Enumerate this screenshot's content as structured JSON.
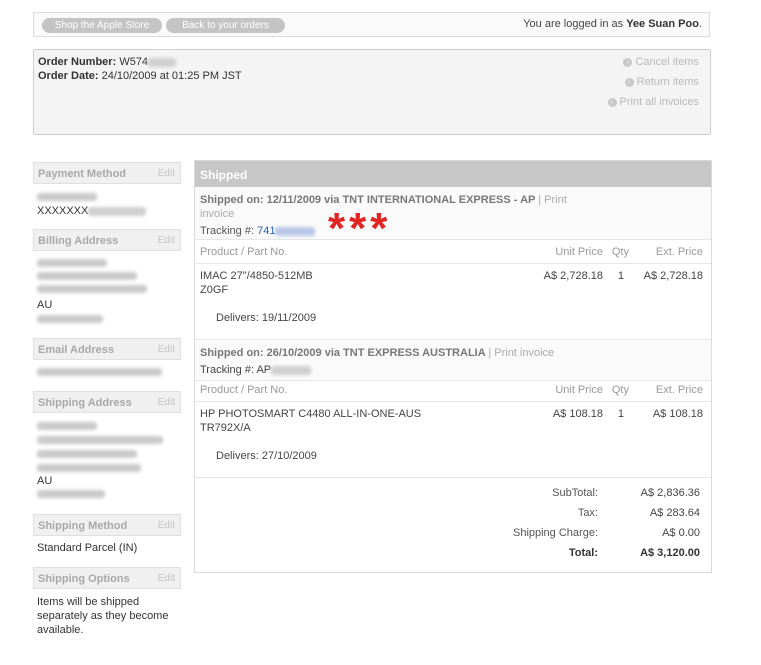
{
  "topbar": {
    "shop_label": "Shop the Apple Store",
    "back_label": "Back to your orders",
    "logged_in_prefix": "You are logged in as",
    "user_name": "Yee Suan Poo",
    "user_suffix": "."
  },
  "order": {
    "number_label": "Order Number:",
    "number_visible": "W574",
    "date_label": "Order Date:",
    "date_value": "24/10/2009 at 01:25 PM JST",
    "actions": [
      "Cancel items",
      "Return items",
      "Print all invoices"
    ]
  },
  "sidebar": {
    "edit_label": "Edit",
    "payment": {
      "title": "Payment Method",
      "value_visible": "XXXXXXX"
    },
    "billing": {
      "title": "Billing Address",
      "country": "AU"
    },
    "email": {
      "title": "Email Address"
    },
    "shipping_address": {
      "title": "Shipping Address",
      "country": "AU"
    },
    "shipping_method": {
      "title": "Shipping Method",
      "value": "Standard Parcel (IN)"
    },
    "shipping_options": {
      "title": "Shipping Options",
      "value": "Items will be shipped separately as they become available."
    }
  },
  "main": {
    "header": "Shipped",
    "columns": {
      "product": "Product / Part No.",
      "unit_price": "Unit Price",
      "qty": "Qty",
      "ext_price": "Ext. Price"
    },
    "print_invoice_label": "Print invoice",
    "tracking_label": "Tracking #:",
    "shipments": [
      {
        "shipped_on": "Shipped on: 12/11/2009 via TNT INTERNATIONAL EXPRESS - AP",
        "separator": "|",
        "print_invoice_line1": "Print",
        "print_invoice_line2": "invoice",
        "tracking_visible": "741",
        "product_name": "IMAC 27\"/4850-512MB",
        "part_no": "Z0GF",
        "unit_price": "A$ 2,728.18",
        "qty": "1",
        "ext_price": "A$ 2,728.18",
        "delivers": "Delivers: 19/11/2009"
      },
      {
        "shipped_on": "Shipped on: 26/10/2009 via TNT EXPRESS AUSTRALIA",
        "separator": "|",
        "print_invoice": "Print invoice",
        "tracking_visible": "AP",
        "product_name": "HP PHOTOSMART C4480 ALL-IN-ONE-AUS",
        "part_no": "TR792X/A",
        "unit_price": "A$ 108.18",
        "qty": "1",
        "ext_price": "A$ 108.18",
        "delivers": "Delivers: 27/10/2009"
      }
    ],
    "totals": {
      "subtotal_label": "SubTotal:",
      "subtotal": "A$ 2,836.36",
      "tax_label": "Tax:",
      "tax": "A$ 283.64",
      "shipping_label": "Shipping Charge:",
      "shipping": "A$ 0.00",
      "total_label": "Total:",
      "total": "A$ 3,120.00"
    },
    "annotation": "***"
  },
  "colors": {
    "accent_red": "#e02424",
    "header_gray": "#c7c7c7",
    "link_blue": "#1f5fb8"
  }
}
